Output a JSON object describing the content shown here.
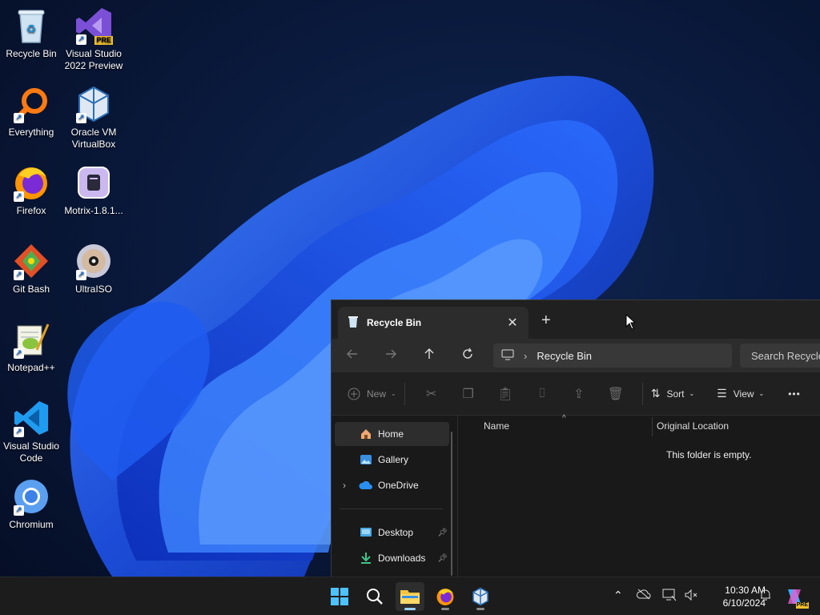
{
  "desktop": {
    "icons": [
      {
        "label": "Recycle Bin"
      },
      {
        "label": "Visual Studio 2022 Preview",
        "badge": "PRE"
      },
      {
        "label": "Everything"
      },
      {
        "label": "Oracle VM VirtualBox"
      },
      {
        "label": "Firefox"
      },
      {
        "label": "Motrix-1.8.1..."
      },
      {
        "label": "Git Bash"
      },
      {
        "label": "UltraISO"
      },
      {
        "label": "Notepad++"
      },
      {
        "label": "Visual Studio Code"
      },
      {
        "label": "Chromium"
      }
    ]
  },
  "explorer": {
    "tab_title": "Recycle Bin",
    "tab_close": "✕",
    "new_tab": "+",
    "address": {
      "location": "Recycle Bin"
    },
    "search_placeholder": "Search Recycle",
    "toolbar": {
      "new_label": "New",
      "sort_label": "Sort",
      "view_label": "View",
      "more_label": "•••"
    },
    "nav": [
      {
        "label": "Home",
        "selected": true
      },
      {
        "label": "Gallery"
      },
      {
        "label": "OneDrive",
        "expandable": true
      },
      {
        "label": "Desktop",
        "pinned": true
      },
      {
        "label": "Downloads",
        "pinned": true
      }
    ],
    "columns": {
      "name": "Name",
      "original_location": "Original Location"
    },
    "empty_message": "This folder is empty."
  },
  "taskbar": {
    "clock_time": "10:30 AM",
    "clock_date": "6/10/2024",
    "copilot_badge": "PRE"
  },
  "colors": {
    "accent": "#4cc2ff",
    "window_bg": "#191919",
    "taskbar_bg": "#1c1c1c"
  }
}
